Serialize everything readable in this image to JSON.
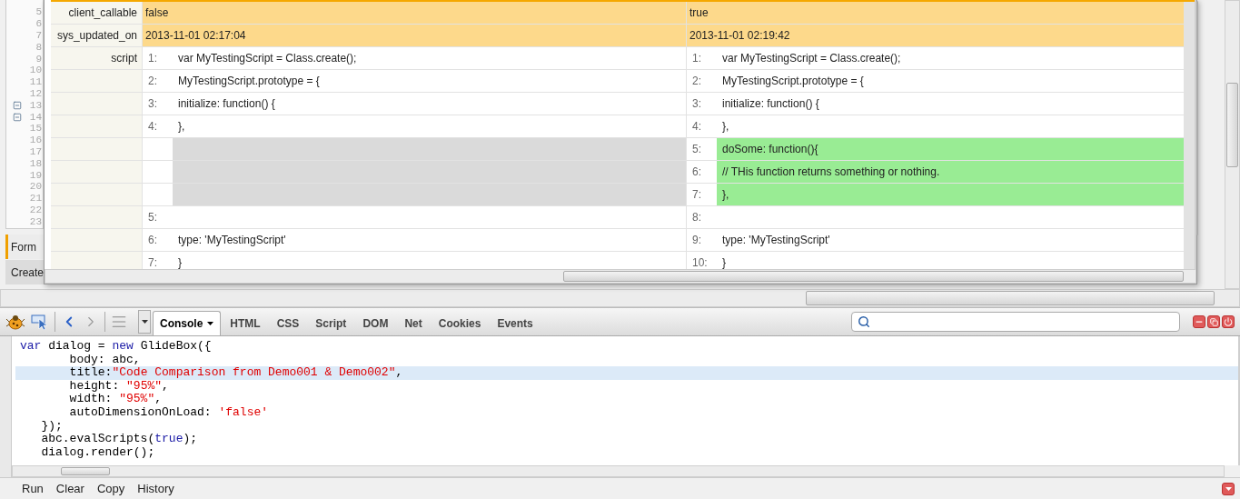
{
  "editor": {
    "lines": [
      {
        "number": "5",
        "fold": false
      },
      {
        "number": "6",
        "fold": false
      },
      {
        "number": "7",
        "fold": false
      },
      {
        "number": "8",
        "fold": false
      },
      {
        "number": "9",
        "fold": false
      },
      {
        "number": "10",
        "fold": false
      },
      {
        "number": "11",
        "fold": false
      },
      {
        "number": "12",
        "fold": false
      },
      {
        "number": "13",
        "fold": true
      },
      {
        "number": "14",
        "fold": true
      },
      {
        "number": "15",
        "fold": false
      },
      {
        "number": "16",
        "fold": false
      },
      {
        "number": "17",
        "fold": false
      },
      {
        "number": "18",
        "fold": false
      },
      {
        "number": "19",
        "fold": false
      },
      {
        "number": "20",
        "fold": false
      },
      {
        "number": "21",
        "fold": false
      },
      {
        "number": "22",
        "fold": false
      },
      {
        "number": "23",
        "fold": false
      }
    ]
  },
  "side_tabs": [
    {
      "label": "Form",
      "selected": true
    },
    {
      "label": "Create",
      "selected": false
    }
  ],
  "dialog": {
    "fields": [
      {
        "label": "client_callable",
        "left": "false",
        "right": "true"
      },
      {
        "label": "sys_updated_on",
        "left": "2013-11-01 02:17:04",
        "right": "2013-11-01 02:19:42"
      }
    ],
    "script_label": "script",
    "diff_rows": [
      {
        "kind": "same",
        "left_number": "1:",
        "left_code": "var MyTestingScript = Class.create();",
        "right_number": "1:",
        "right_code": "var MyTestingScript = Class.create();"
      },
      {
        "kind": "same",
        "left_number": "2:",
        "left_code": "MyTestingScript.prototype = {",
        "right_number": "2:",
        "right_code": "MyTestingScript.prototype = {"
      },
      {
        "kind": "same",
        "left_number": "3:",
        "left_code": "initialize: function() {",
        "right_number": "3:",
        "right_code": "initialize: function() {"
      },
      {
        "kind": "same",
        "left_number": "4:",
        "left_code": "},",
        "right_number": "4:",
        "right_code": "},"
      },
      {
        "kind": "added",
        "right_number": "5:",
        "right_code": "doSome: function(){"
      },
      {
        "kind": "added",
        "right_number": "6:",
        "right_code": "// THis function returns something or nothing."
      },
      {
        "kind": "added",
        "right_number": "7:",
        "right_code": "},"
      },
      {
        "kind": "same",
        "left_number": "5:",
        "right_number": "8:"
      },
      {
        "kind": "same",
        "left_number": "6:",
        "left_code": "type: 'MyTestingScript'",
        "right_number": "9:",
        "right_code": "type: 'MyTestingScript'"
      },
      {
        "kind": "same",
        "left_number": "7:",
        "left_code": "}",
        "right_number": "10:",
        "right_code": "}"
      }
    ]
  },
  "toolbar": {
    "tabs": [
      {
        "label": "Console",
        "selected": true,
        "menu": true
      },
      {
        "label": "HTML",
        "selected": false,
        "menu": false
      },
      {
        "label": "CSS",
        "selected": false,
        "menu": false
      },
      {
        "label": "Script",
        "selected": false,
        "menu": false
      },
      {
        "label": "DOM",
        "selected": false,
        "menu": false
      },
      {
        "label": "Net",
        "selected": false,
        "menu": false
      },
      {
        "label": "Cookies",
        "selected": false,
        "menu": false
      },
      {
        "label": "Events",
        "selected": false,
        "menu": false
      }
    ]
  },
  "console": {
    "lines": [
      {
        "highlighted": false,
        "tokens": [
          {
            "kind": "keyword",
            "text": "var"
          },
          {
            "kind": "plain",
            "text": " dialog = "
          },
          {
            "kind": "keyword",
            "text": "new"
          },
          {
            "kind": "plain",
            "text": " GlideBox({"
          }
        ]
      },
      {
        "highlighted": false,
        "tokens": [
          {
            "kind": "plain",
            "text": "       body: abc,"
          }
        ]
      },
      {
        "highlighted": true,
        "tokens": [
          {
            "kind": "plain",
            "text": "       title:"
          },
          {
            "kind": "string",
            "text": "\"Code Comparison from Demo001 & Demo002\""
          },
          {
            "kind": "plain",
            "text": ","
          }
        ]
      },
      {
        "highlighted": false,
        "tokens": [
          {
            "kind": "plain",
            "text": "       height: "
          },
          {
            "kind": "string",
            "text": "\"95%\""
          },
          {
            "kind": "plain",
            "text": ","
          }
        ]
      },
      {
        "highlighted": false,
        "tokens": [
          {
            "kind": "plain",
            "text": "       width: "
          },
          {
            "kind": "string",
            "text": "\"95%\""
          },
          {
            "kind": "plain",
            "text": ","
          }
        ]
      },
      {
        "highlighted": false,
        "tokens": [
          {
            "kind": "plain",
            "text": "       autoDimensionOnLoad: "
          },
          {
            "kind": "string",
            "text": "'false'"
          }
        ]
      },
      {
        "highlighted": false,
        "tokens": [
          {
            "kind": "plain",
            "text": "   });"
          }
        ]
      },
      {
        "highlighted": false,
        "tokens": [
          {
            "kind": "plain",
            "text": "   abc.evalScripts("
          },
          {
            "kind": "keyword",
            "text": "true"
          },
          {
            "kind": "plain",
            "text": ");"
          }
        ]
      },
      {
        "highlighted": false,
        "tokens": [
          {
            "kind": "plain",
            "text": "   dialog.render();"
          }
        ]
      }
    ]
  },
  "actions": [
    "Run",
    "Clear",
    "Copy",
    "History"
  ]
}
